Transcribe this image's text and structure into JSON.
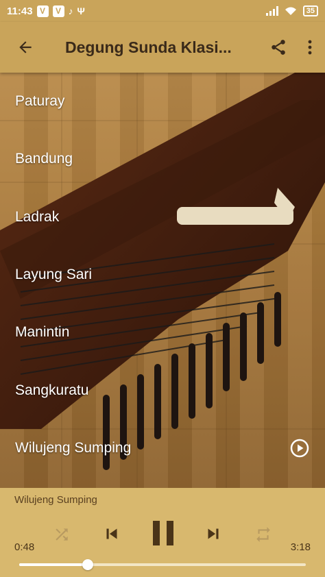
{
  "statusbar": {
    "time": "11:43",
    "badge1": "V",
    "badge2": "V",
    "battery": "35",
    "icons": [
      "music-note-icon",
      "usb-icon",
      "signal-icon",
      "wifi-icon",
      "battery-icon"
    ]
  },
  "appbar": {
    "title": "Degung Sunda Klasi...",
    "icons": [
      "back-arrow-icon",
      "share-icon",
      "more-vert-icon"
    ]
  },
  "tracks": [
    {
      "label": "Paturay"
    },
    {
      "label": "Bandung"
    },
    {
      "label": "Ladrak"
    },
    {
      "label": "Layung Sari"
    },
    {
      "label": "Manintin"
    },
    {
      "label": "Sangkuratu"
    },
    {
      "label": "Wilujeng Sumping",
      "playing": true
    }
  ],
  "player": {
    "now_playing": "Wilujeng Sumping",
    "current_time": "0:48",
    "total_time": "3:18",
    "progress": 0.24,
    "icons": [
      "shuffle-icon",
      "skip-previous-icon",
      "pause-icon",
      "skip-next-icon",
      "repeat-icon"
    ]
  },
  "colors": {
    "appbar": "#c9a45a",
    "player": "#d8b86e",
    "title_text": "#3a2a1a"
  }
}
